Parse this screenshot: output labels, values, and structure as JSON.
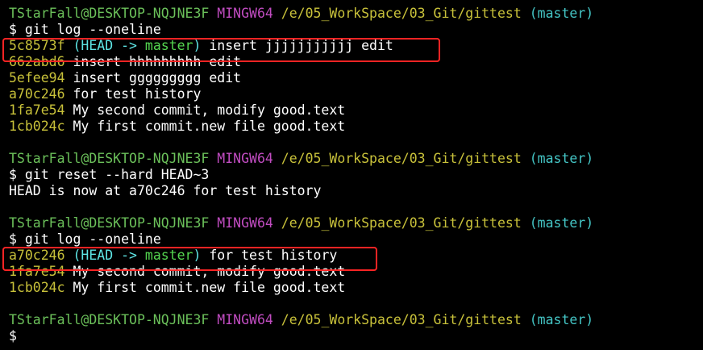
{
  "prompt": {
    "user_host": "TStarFall@DESKTOP-NQJNE3F",
    "system": "MINGW64",
    "path": "/e/05_WorkSpace/03_Git/gittest",
    "branch": "(master)",
    "symbol": "$"
  },
  "commands": {
    "log1": "git log --oneline",
    "reset": "git reset --hard HEAD~3",
    "log2": "git log --oneline"
  },
  "log1": [
    {
      "hash": "5c8573f",
      "head": "(HEAD -> ",
      "master": "master",
      "close": ")",
      "message": " insert jjjjjjjjjjj edit"
    },
    {
      "hash": "662abd6",
      "message": " insert hhhhhhhhh edit"
    },
    {
      "hash": "5efee94",
      "message": " insert ggggggggg edit"
    },
    {
      "hash": "a70c246",
      "message": " for test history"
    },
    {
      "hash": "1fa7e54",
      "message": " My second commit, modify good.text"
    },
    {
      "hash": "1cb024c",
      "message": " My first commit.new file good.text"
    }
  ],
  "reset_output": "HEAD is now at a70c246 for test history",
  "log2": [
    {
      "hash": "a70c246",
      "head": "(HEAD -> ",
      "master": "master",
      "close": ")",
      "message": " for test history"
    },
    {
      "hash": "1fa7e54",
      "message": " My second commit, modify good.text"
    },
    {
      "hash": "1cb024c",
      "message": " My first commit.new file good.text"
    }
  ],
  "colors": {
    "background": "#000000",
    "user_host": "#6bc05a",
    "system": "#c04cc0",
    "path": "#c8c13a",
    "branch": "#44c5c5",
    "hash": "#c8c13a",
    "highlight_border": "#ff2424"
  }
}
